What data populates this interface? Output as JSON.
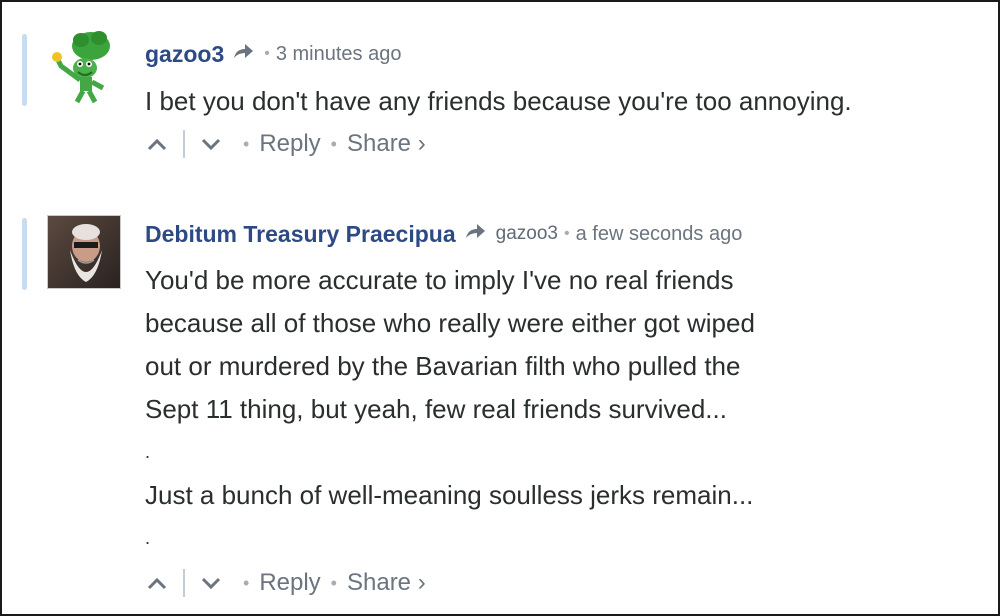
{
  "comments": [
    {
      "author": "gazoo3",
      "reply_to": "",
      "time": "3 minutes ago",
      "lines": [
        "I bet you don't have any friends because you're too annoying."
      ],
      "actions": {
        "reply": "Reply",
        "share": "Share ›"
      }
    },
    {
      "author": "Debitum Treasury Praecipua",
      "reply_to": "gazoo3",
      "time": "a few seconds ago",
      "lines": [
        "You'd be more accurate to imply I've no real friends",
        "because all of those who really were either got wiped",
        "out or murdered by the Bavarian filth who pulled the",
        "Sept 11 thing, but yeah, few real friends survived...",
        ".",
        "Just a bunch of well-meaning soulless jerks remain...",
        "."
      ],
      "actions": {
        "reply": "Reply",
        "share": "Share ›"
      }
    }
  ],
  "colors": {
    "author": "#2e4a84",
    "meta": "#6b747f",
    "thread_bar": "#c9dbef",
    "text": "#2a2e2e"
  },
  "icons": [
    "upvote-icon",
    "downvote-icon",
    "reply-arrow-icon",
    "share-chevron-icon"
  ]
}
